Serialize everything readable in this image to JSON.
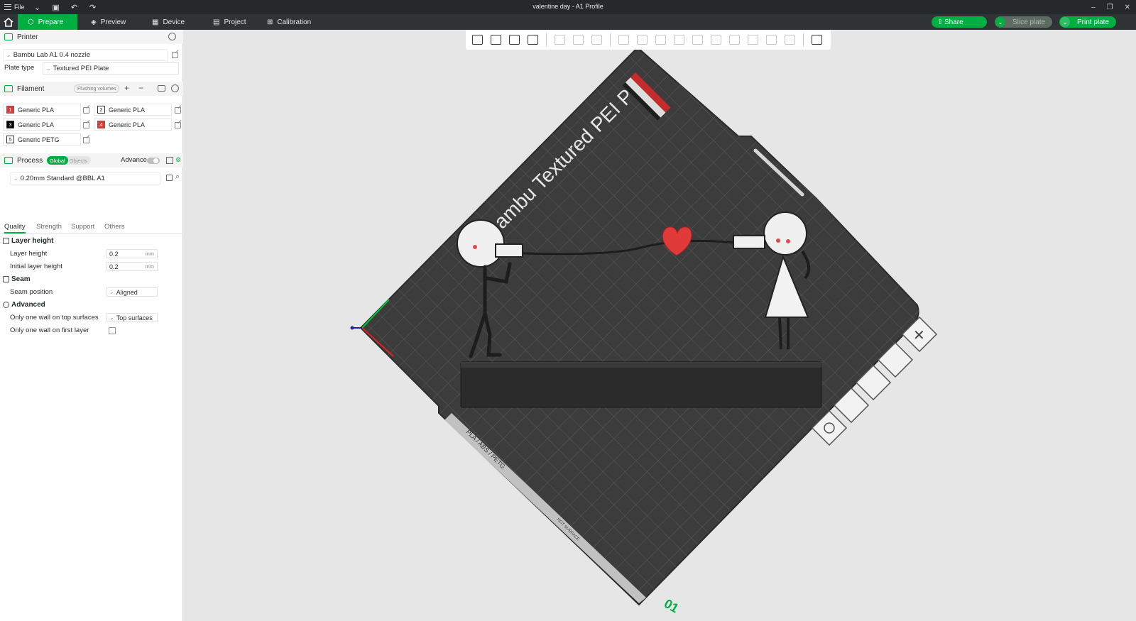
{
  "window": {
    "file_menu": "File",
    "title": "valentine day - A1 Profile"
  },
  "tabs": [
    {
      "label": "Prepare"
    },
    {
      "label": "Preview"
    },
    {
      "label": "Device"
    },
    {
      "label": "Project"
    },
    {
      "label": "Calibration"
    }
  ],
  "actions": {
    "share": "Share",
    "slice": "Slice plate",
    "print": "Print plate"
  },
  "printer": {
    "section_title": "Printer",
    "name": "Bambu Lab A1 0.4 nozzle",
    "plate_type_label": "Plate type",
    "plate_type": "Textured PEI Plate"
  },
  "filament": {
    "section_title": "Filament",
    "flushing_button": "Flushing volumes",
    "items": [
      {
        "num": "1",
        "name": "Generic PLA",
        "color": "#d43d3d"
      },
      {
        "num": "2",
        "name": "Generic PLA",
        "color": "#ffffff"
      },
      {
        "num": "3",
        "name": "Generic PLA",
        "color": "#000000"
      },
      {
        "num": "4",
        "name": "Generic PLA",
        "color": "#d43d3d"
      },
      {
        "num": "5",
        "name": "Generic PETG",
        "color": "#ffffff"
      }
    ]
  },
  "process": {
    "section_title": "Process",
    "toggle_global": "Global",
    "toggle_objects": "Objects",
    "advance_label": "Advance",
    "preset": "0.20mm Standard @BBL A1",
    "subtabs": [
      "Quality",
      "Strength",
      "Support",
      "Others"
    ],
    "groups": {
      "layer_height": {
        "title": "Layer height",
        "layer_height_label": "Layer height",
        "layer_height_value": "0.2",
        "initial_label": "Initial layer height",
        "initial_value": "0.2",
        "unit": "mm"
      },
      "seam": {
        "title": "Seam",
        "position_label": "Seam position",
        "position_value": "Aligned"
      },
      "advanced": {
        "title": "Advanced",
        "one_wall_top_label": "Only one wall on top surfaces",
        "one_wall_top_value": "Top surfaces",
        "one_wall_first_label": "Only one wall on first layer"
      }
    }
  },
  "plate": {
    "label_text": "Bambu Textured PEI P",
    "side_label": "PLA / ABS / PETG",
    "hot_surface": "HOT SURFACE",
    "plate_number": "01"
  },
  "colors": {
    "accent": "#00ae42",
    "plate": "#3c3c3c",
    "heart": "#e03a3a"
  }
}
